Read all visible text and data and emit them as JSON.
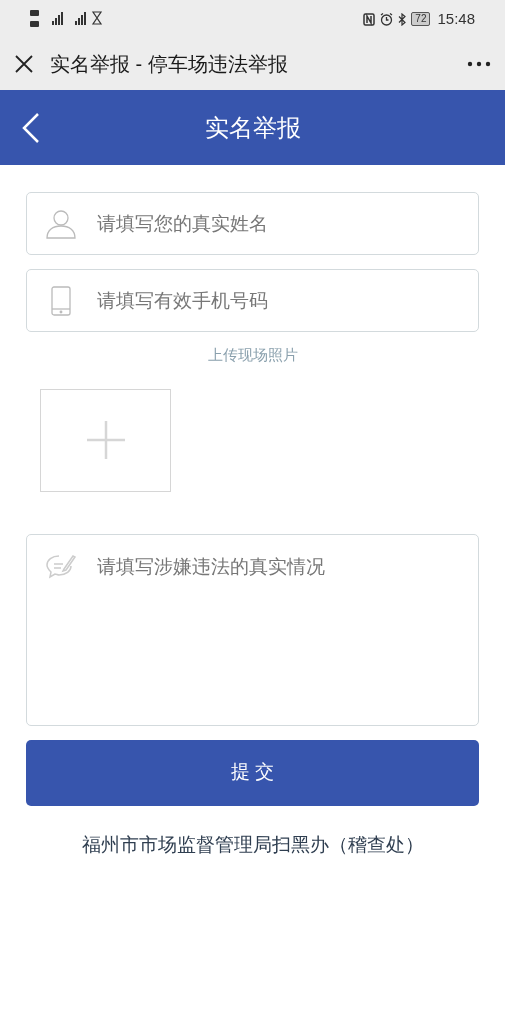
{
  "status_bar": {
    "battery": "72",
    "time": "15:48"
  },
  "window": {
    "title": "实名举报 - 停车场违法举报"
  },
  "header": {
    "title": "实名举报"
  },
  "fields": [
    {
      "kind": "name",
      "placeholder": "请填写您的真实姓名"
    },
    {
      "kind": "phone",
      "placeholder": "请填写有效手机号码"
    }
  ],
  "upload": {
    "label": "上传现场照片"
  },
  "description": {
    "placeholder": "请填写涉嫌违法的真实情况"
  },
  "submit": {
    "label": "提 交"
  },
  "footer": {
    "text": "福州市市场监督管理局扫黑办（稽查处）"
  }
}
